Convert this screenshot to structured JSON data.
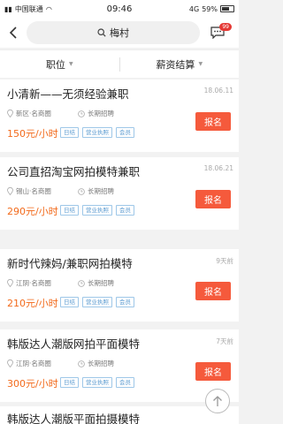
{
  "status": {
    "carrier": "中国联通",
    "time": "09:46",
    "network": "4G",
    "battery": "59%"
  },
  "header": {
    "search_text": "梅村",
    "message_badge": "99"
  },
  "filters": {
    "position_label": "职位",
    "pay_label": "薪资结算"
  },
  "jobs": [
    {
      "title": "小清新——无须经验兼职",
      "date": "18.06.11",
      "location": "新区·名商圈",
      "term": "长期招聘",
      "salary": "150元/小时",
      "tags": [
        "日结",
        "营业执照",
        "会员"
      ],
      "apply_label": "报名"
    },
    {
      "title": "公司直招淘宝网拍模特兼职",
      "date": "18.06.21",
      "location": "锡山·名商圈",
      "term": "长期招聘",
      "salary": "290元/小时",
      "tags": [
        "日结",
        "营业执照",
        "会员"
      ],
      "apply_label": "报名"
    },
    {
      "title": "新时代辣妈/兼职网拍模特",
      "date": "9天前",
      "location": "江阴·名商圈",
      "term": "长期招聘",
      "salary": "210元/小时",
      "tags": [
        "日结",
        "营业执照",
        "会员"
      ],
      "apply_label": "报名"
    },
    {
      "title": "韩版达人潮版网拍平面模特",
      "date": "7天前",
      "location": "江阴·名商圈",
      "term": "长期招聘",
      "salary": "300元/小时",
      "tags": [
        "日结",
        "营业执照",
        "会员"
      ],
      "apply_label": "报名"
    }
  ],
  "partial_title": "韩版达人潮版平面拍摄模特",
  "icons": {
    "back": "chevron-left-icon",
    "search": "search-icon",
    "message": "message-icon",
    "location": "location-pin-icon",
    "clock": "clock-icon",
    "scroll_top": "arrow-up-icon"
  },
  "colors": {
    "accent": "#f55a3c",
    "salary": "#f26a1b",
    "tag": "#5a9ad0"
  }
}
